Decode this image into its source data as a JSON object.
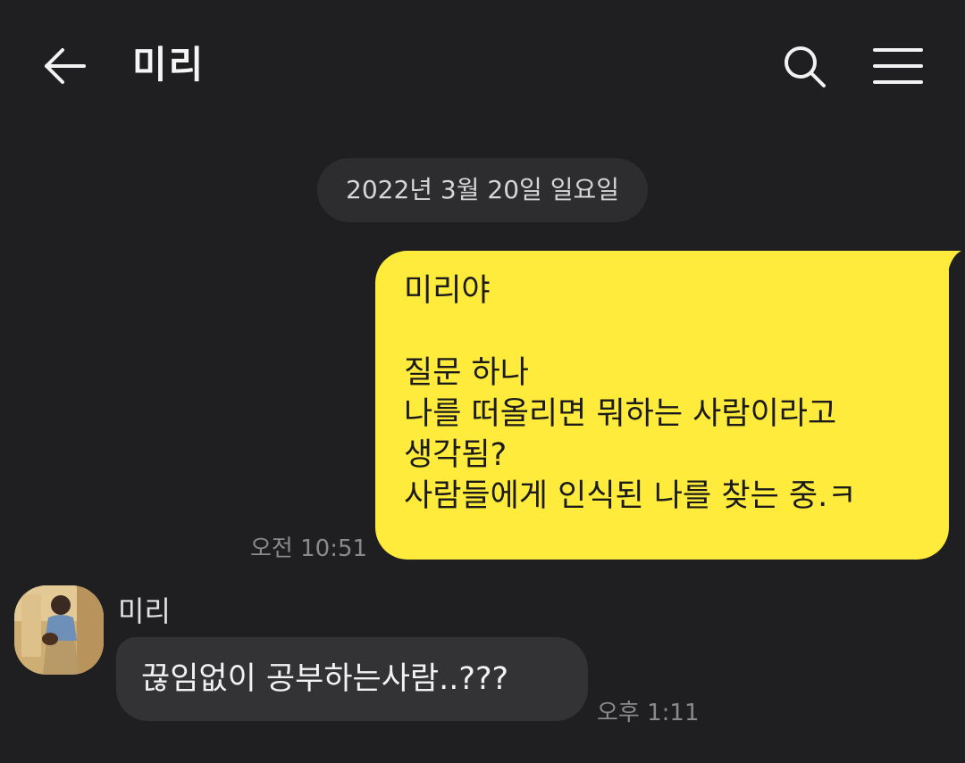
{
  "header": {
    "title": "미리",
    "back_icon": "arrow-left-icon",
    "search_icon": "search-icon",
    "menu_icon": "hamburger-menu-icon"
  },
  "date_divider": "2022년 3월 20일 일요일",
  "messages": [
    {
      "direction": "sent",
      "lines": [
        "미리야",
        "",
        "질문 하나",
        "나를 떠올리면 뭐하는 사람이라고",
        "생각됨?",
        "사람들에게 인식된 나를 찾는 중.ㅋ"
      ],
      "time": "오전 10:51"
    },
    {
      "direction": "received",
      "sender": "미리",
      "text": "끊임없이 공부하는사람..???",
      "time": "오후 1:11"
    }
  ],
  "colors": {
    "background": "#1f1f21",
    "sent_bubble": "#ffeb3b",
    "received_bubble": "#333336",
    "date_pill": "#2d2d30",
    "timestamp": "#8a8a8a"
  }
}
